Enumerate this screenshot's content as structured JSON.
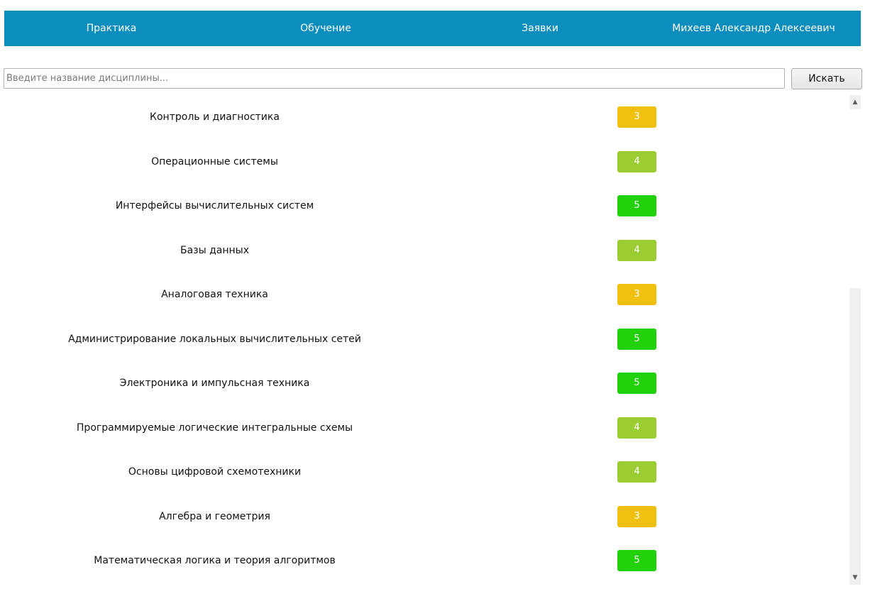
{
  "nav": {
    "practice": "Практика",
    "study": "Обучение",
    "requests": "Заявки",
    "user": "Михеев Александр Алексеевич"
  },
  "search": {
    "placeholder": "Введите название дисциплины...",
    "value": "",
    "button_label": "Искать"
  },
  "colors": {
    "header": "#0b8dbd",
    "grade_3": "#f0c010",
    "grade_4": "#9acd32",
    "grade_5": "#22d10c"
  },
  "subjects": [
    {
      "name": "Контроль и диагностика",
      "grade": "3"
    },
    {
      "name": "Операционные системы",
      "grade": "4"
    },
    {
      "name": "Интерфейсы вычислительных систем",
      "grade": "5"
    },
    {
      "name": "Базы данных",
      "grade": "4"
    },
    {
      "name": "Аналоговая техника",
      "grade": "3"
    },
    {
      "name": "Администрирование локальных вычислительных сетей",
      "grade": "5"
    },
    {
      "name": "Электроника и импульсная техника",
      "grade": "5"
    },
    {
      "name": "Программируемые логические интегральные схемы",
      "grade": "4"
    },
    {
      "name": "Основы цифровой схемотехники",
      "grade": "4"
    },
    {
      "name": "Алгебра и геометрия",
      "grade": "3"
    },
    {
      "name": "Математическая логика и теория алгоритмов",
      "grade": "5"
    }
  ],
  "scrollbar": {
    "up_icon": "▲",
    "down_icon": "▼"
  }
}
